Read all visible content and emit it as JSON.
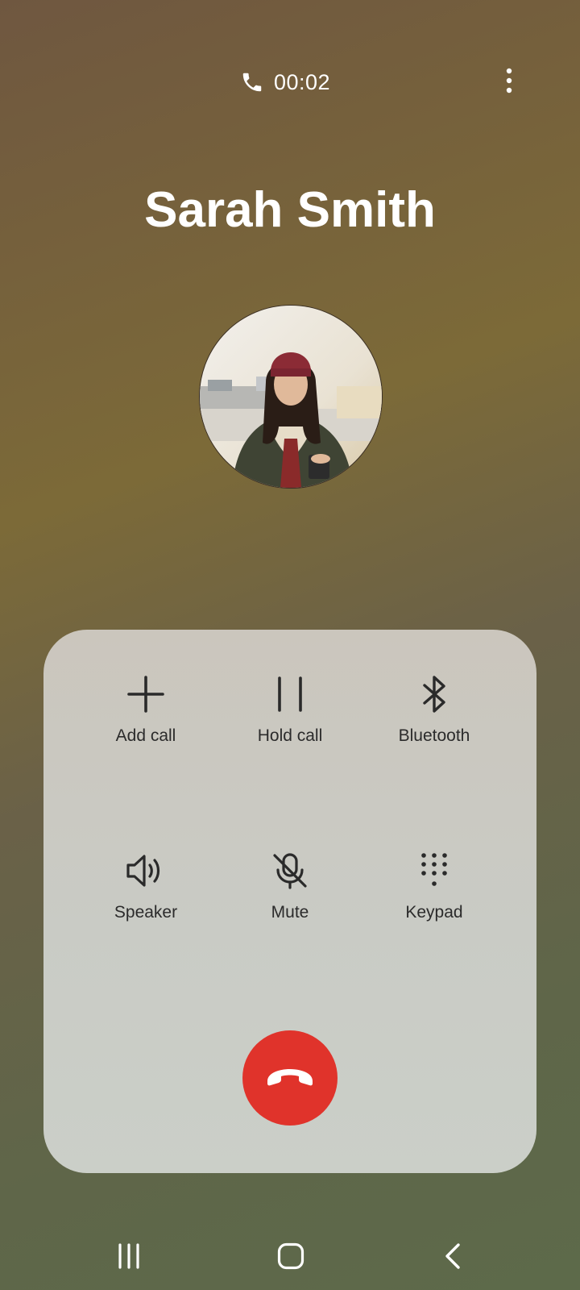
{
  "status_bar": {
    "call_icon": "phone-icon",
    "timer": "00:02",
    "more_icon": "more-vertical-icon"
  },
  "caller": {
    "name": "Sarah Smith",
    "avatar": "contact-photo"
  },
  "controls": [
    {
      "key": "add_call",
      "label": "Add call",
      "icon": "plus-icon"
    },
    {
      "key": "hold_call",
      "label": "Hold call",
      "icon": "pause-icon"
    },
    {
      "key": "bluetooth",
      "label": "Bluetooth",
      "icon": "bluetooth-icon"
    },
    {
      "key": "speaker",
      "label": "Speaker",
      "icon": "speaker-icon"
    },
    {
      "key": "mute",
      "label": "Mute",
      "icon": "mic-off-icon"
    },
    {
      "key": "keypad",
      "label": "Keypad",
      "icon": "keypad-icon"
    }
  ],
  "end_call": {
    "icon": "end-call-icon",
    "color": "#e0332b"
  },
  "navigation": {
    "recents_icon": "recents-icon",
    "home_icon": "home-icon",
    "back_icon": "back-icon"
  },
  "colors": {
    "panel": "#cbc9c2",
    "end_call_red": "#e0332b",
    "text_light": "#ffffff",
    "text_dark": "#2b2b2b"
  }
}
